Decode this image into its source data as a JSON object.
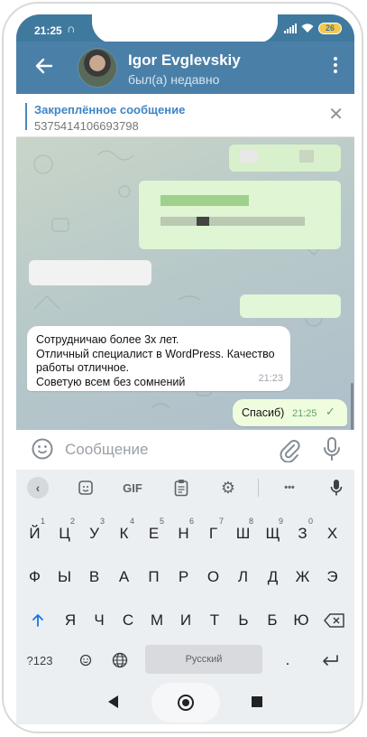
{
  "status_bar": {
    "time": "21:25",
    "battery": "26"
  },
  "header": {
    "name": "Igor Evglevskiy",
    "status": "был(а) недавно"
  },
  "pinned": {
    "title": "Закреплённое сообщение",
    "text": "5375414106693798"
  },
  "messages": [
    {
      "direction": "incoming",
      "lines": [
        "Сотрудничаю более 3х лет.",
        "Отличный специалист в WordPress. Качество",
        "работы отличное.",
        "Советую всем без сомнений"
      ],
      "time": "21:23"
    },
    {
      "direction": "outgoing",
      "text": "Спасиб)",
      "time": "21:25",
      "read": true
    }
  ],
  "input": {
    "placeholder": "Сообщение"
  },
  "keyboard": {
    "toolbar": {
      "gif": "GIF",
      "more": "•••"
    },
    "row1": [
      {
        "k": "Й",
        "n": "1"
      },
      {
        "k": "Ц",
        "n": "2"
      },
      {
        "k": "У",
        "n": "3"
      },
      {
        "k": "К",
        "n": "4"
      },
      {
        "k": "Е",
        "n": "5"
      },
      {
        "k": "Н",
        "n": "6"
      },
      {
        "k": "Г",
        "n": "7"
      },
      {
        "k": "Ш",
        "n": "8"
      },
      {
        "k": "Щ",
        "n": "9"
      },
      {
        "k": "З",
        "n": "0"
      },
      {
        "k": "Х",
        "n": ""
      }
    ],
    "row2": [
      "Ф",
      "Ы",
      "В",
      "А",
      "П",
      "Р",
      "О",
      "Л",
      "Д",
      "Ж",
      "Э"
    ],
    "row3": [
      "Я",
      "Ч",
      "С",
      "М",
      "И",
      "Т",
      "Ь",
      "Б",
      "Ю"
    ],
    "row4": {
      "numbers": "?123",
      "space": "Русский",
      "period": "."
    }
  }
}
